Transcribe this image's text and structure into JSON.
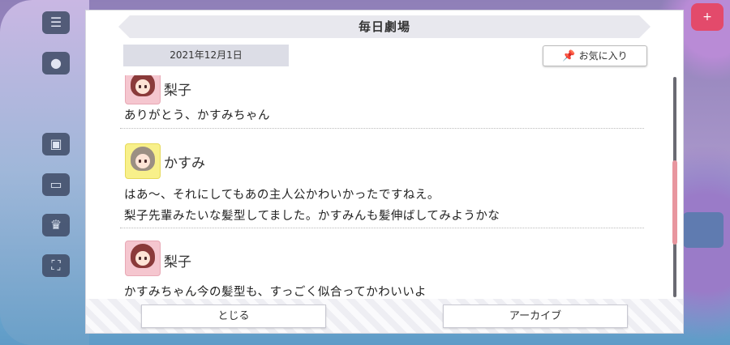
{
  "dialog": {
    "title": "毎日劇場",
    "date": "2021年12月1日",
    "favorite_label": "お気に入り"
  },
  "entries": [
    {
      "speaker": "梨子",
      "lines": [
        "ありがとう、かすみちゃん"
      ]
    },
    {
      "speaker": "かすみ",
      "lines": [
        "はあ〜、それにしてもあの主人公かわいかったですねえ。",
        "梨子先輩みたいな髪型してました。かすみんも髪伸ばしてみようかな"
      ]
    },
    {
      "speaker": "梨子",
      "lines": [
        "かすみちゃん今の髪型も、すっごく似合ってかわいいよ"
      ]
    }
  ],
  "footer": {
    "close_label": "とじる",
    "archive_label": "アーカイブ"
  },
  "colors": {
    "scroll_thumb": "#e8969f",
    "riko_avatar_bg": "#f5c6cf",
    "kasumi_avatar_bg": "#f8f08a"
  },
  "icons": [
    "menu-icon",
    "pin-icon"
  ]
}
